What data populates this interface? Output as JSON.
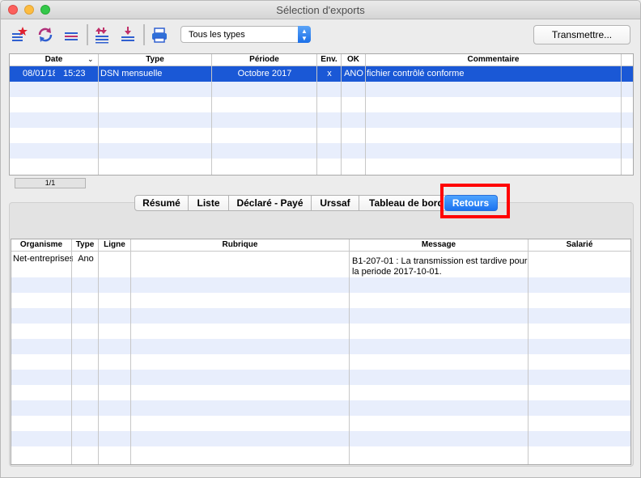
{
  "window": {
    "title": "Sélection d'exports"
  },
  "toolbar": {
    "icons": [
      "list-star-icon",
      "refresh-icon",
      "list-lines-icon",
      "import-arrows-icon",
      "download-icon",
      "print-icon"
    ],
    "type_select": "Tous les types",
    "transmit_button": "Transmettre..."
  },
  "exports_table": {
    "headers": [
      "Date",
      "Type",
      "Période",
      "Env.",
      "OK",
      "Commentaire"
    ],
    "rows": [
      {
        "date": "08/01/18",
        "time": "15:23",
        "type": "DSN mensuelle",
        "periode": "Octobre 2017",
        "env": "x",
        "ok": "ANO",
        "commentaire": "fichier contrôlé conforme"
      }
    ],
    "counter": "1/1"
  },
  "tabs": [
    "Résumé",
    "Liste",
    "Déclaré - Payé",
    "Urssaf",
    "Tableau de bord",
    "Retours"
  ],
  "active_tab": "Retours",
  "returns_table": {
    "headers": [
      "Organisme",
      "Type",
      "Ligne",
      "Rubrique",
      "Message",
      "Salarié"
    ],
    "rows": [
      {
        "organisme": "Net-entreprises",
        "type": "Ano",
        "ligne": "",
        "rubrique": "",
        "message_line1": "B1-207-01 : La transmission est tardive pour",
        "message_line2": "la periode 2017-10-01.",
        "salarie": ""
      }
    ]
  },
  "colors": {
    "selection": "#1a58d6",
    "alt_row": "#e8eefc",
    "highlight_box": "#ff0000",
    "active_tab": "#1c72ef"
  }
}
